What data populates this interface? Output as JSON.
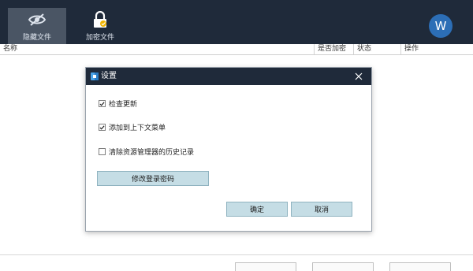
{
  "toolbar": {
    "hide_files_label": "隐藏文件",
    "encrypt_files_label": "加密文件",
    "avatar_letter": "W"
  },
  "table": {
    "columns": [
      "名称",
      "是否加密",
      "状态",
      "操作"
    ]
  },
  "dialog": {
    "title": "设置",
    "options": [
      {
        "label": "检查更新",
        "checked": true
      },
      {
        "label": "添加到上下文菜单",
        "checked": true
      },
      {
        "label": "清除资源管理器的历史记录",
        "checked": false
      }
    ],
    "change_password_label": "修改登录密码",
    "ok_label": "确定",
    "cancel_label": "取消"
  },
  "colors": {
    "toolbar_bg": "#1f2a3a",
    "active_tab_bg": "#4a5564",
    "button_bg": "#c5dde5",
    "avatar_bg": "#2c6eb6"
  }
}
